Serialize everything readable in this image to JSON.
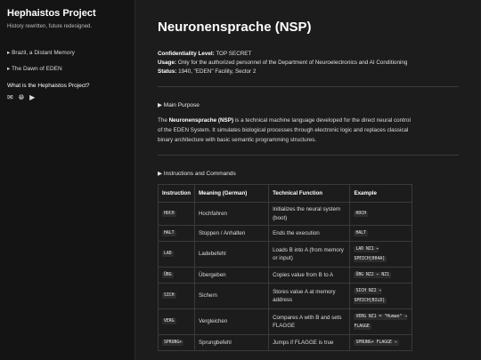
{
  "sidebar": {
    "title": "Hephaistos Project",
    "tagline": "History rewritten, future redesigned.",
    "links": [
      "▸ Brazil, a Distant Memory",
      "▸ The Dawn of EDEN"
    ],
    "section_heading": "What is the Hephaistos Project?",
    "icons": [
      "mail-icon",
      "globe-icon",
      "play-icon"
    ]
  },
  "main": {
    "title": "Neuronensprache (NSP)",
    "meta": {
      "confidentiality_label": "Confidentiality Level:",
      "confidentiality_value": "TOP SECRET",
      "usage_label": "Usage:",
      "usage_value": "Only for the authorized personnel of the Department of Neuroelectronics and AI Conditioning",
      "status_label": "Status:",
      "status_value": "1940, \"EDEN\" Facility, Sector 2"
    },
    "main_purpose": "▶ Main Purpose",
    "para_prefix": "The ",
    "para_bold": "Neuronensprache (NSP)",
    "para_rest": " is a technical machine language developed for the direct neural control of the EDEN System. It simulates biological processes through electronic logic and replaces classical binary architecture with basic semantic programming structures.",
    "instructions": "▶ Instructions and Commands",
    "table": {
      "headers": [
        "Instruction",
        "Meaning (German)",
        "Technical Function",
        "Example"
      ],
      "rows": [
        [
          "HOCH",
          "Hochfahren",
          "Initializes the neural system (boot)",
          "HOCH"
        ],
        [
          "HALT",
          "Stoppen / Anhalten",
          "Ends the execution",
          "HALT"
        ],
        [
          "LAD",
          "Ladebefehl",
          "Loads B into A (from memory or input)",
          "LAD NZ1 ← SPEICH[004A]"
        ],
        [
          "ÜBG",
          "Übergeben",
          "Copies value from B to A",
          "ÜBG NZ2 ← NZ1"
        ],
        [
          "SICH",
          "Sichern",
          "Stores value A at memory address",
          "SICH NZ2 → SPEICH[BILD]"
        ],
        [
          "VERG",
          "Vergleichen",
          "Compares A with B and sets FLAGGE",
          "VERG NZ1 = \"Human\" → FLAGGE"
        ],
        [
          "SPRUNG+",
          "Sprungbefehl",
          "Jumps if FLAGGE is true",
          "SPRUNG+ FLAGGE →"
        ]
      ]
    }
  }
}
